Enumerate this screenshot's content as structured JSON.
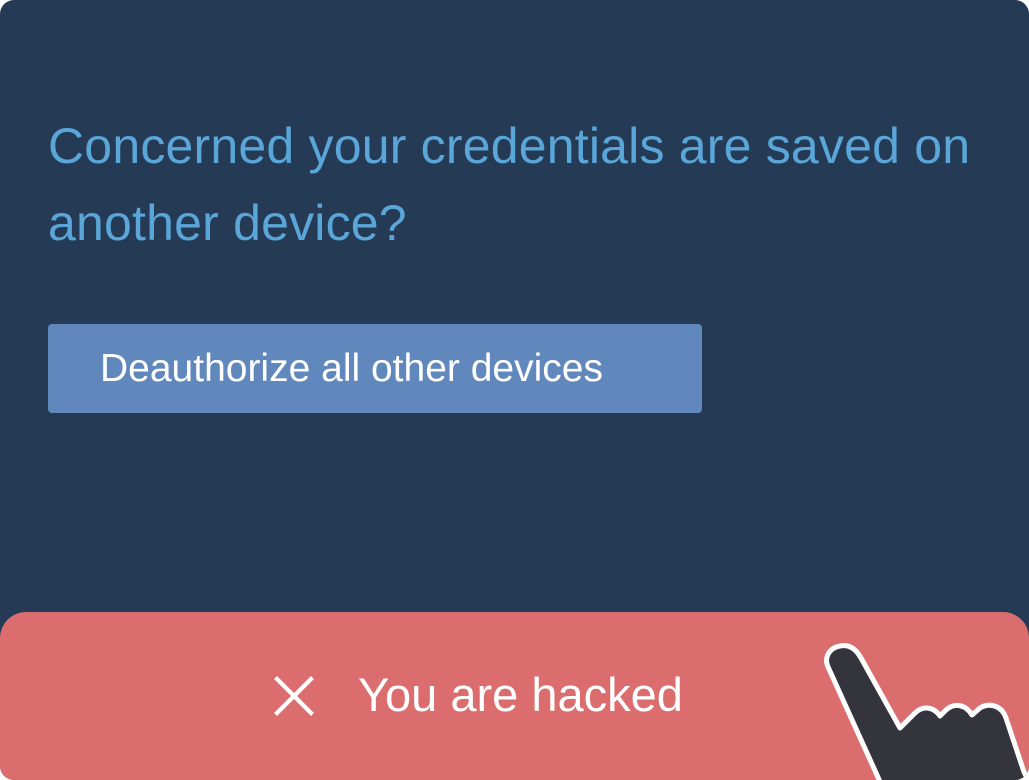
{
  "prompt": {
    "question": "Concerned your credentials are saved on another device?",
    "button_label": "Deauthorize all other devices"
  },
  "banner": {
    "message": "You are hacked",
    "close_icon": "close-icon"
  },
  "cursor": {
    "icon": "hand-pointer-icon"
  },
  "colors": {
    "panel_background": "#243a55",
    "question_text": "#5aa6d8",
    "button_background": "#6188bd",
    "banner_background": "#db6d6e",
    "cursor_fill": "#34343c"
  }
}
